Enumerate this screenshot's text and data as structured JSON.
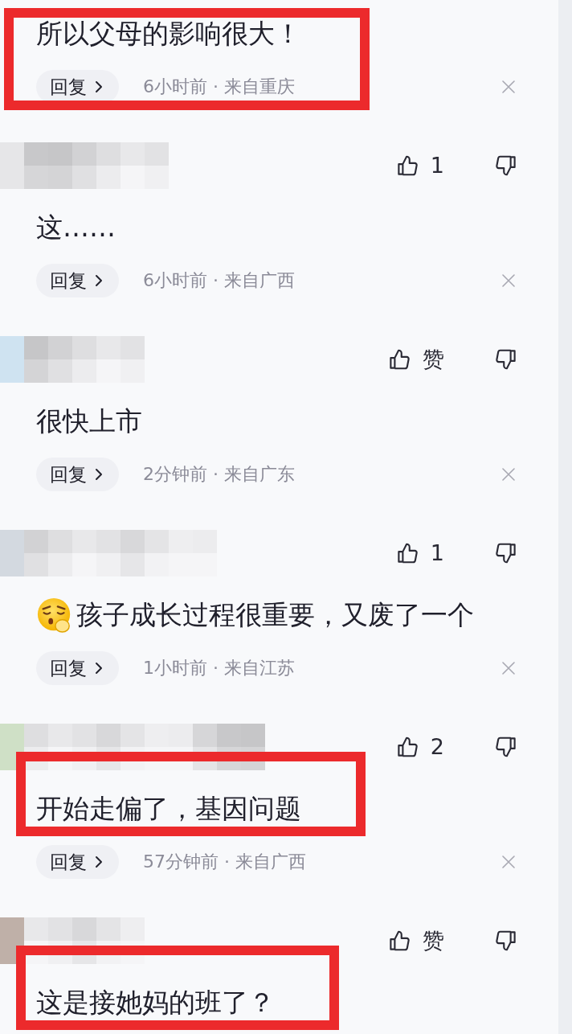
{
  "comments": [
    {
      "highlighted": true,
      "highlight_reply": true,
      "emoji": false,
      "text": "所以父母的影响很大！",
      "reply": {
        "label": "回复",
        "meta": "6小时前 · 来自重庆"
      }
    },
    {
      "likes": "1",
      "highlighted": false,
      "emoji": false,
      "text": "这……",
      "reply": {
        "label": "回复",
        "meta": "6小时前 · 来自广西"
      }
    },
    {
      "likes": "赞",
      "highlighted": false,
      "emoji": false,
      "text": "很快上市",
      "reply": {
        "label": "回复",
        "meta": "2分钟前 · 来自广东"
      }
    },
    {
      "likes": "1",
      "highlighted": false,
      "emoji": true,
      "text": "孩子成长过程很重要，又废了一个",
      "reply": {
        "label": "回复",
        "meta": "1小时前 · 来自江苏"
      }
    },
    {
      "likes": "2",
      "highlighted": true,
      "highlight_reply": false,
      "emoji": false,
      "text": "开始走偏了，基因问题",
      "reply": {
        "label": "回复",
        "meta": "57分钟前 · 来自广西"
      }
    },
    {
      "likes": "赞",
      "highlighted": true,
      "highlight_reply": false,
      "emoji": false,
      "text": "这是接她妈的班了？"
    }
  ]
}
